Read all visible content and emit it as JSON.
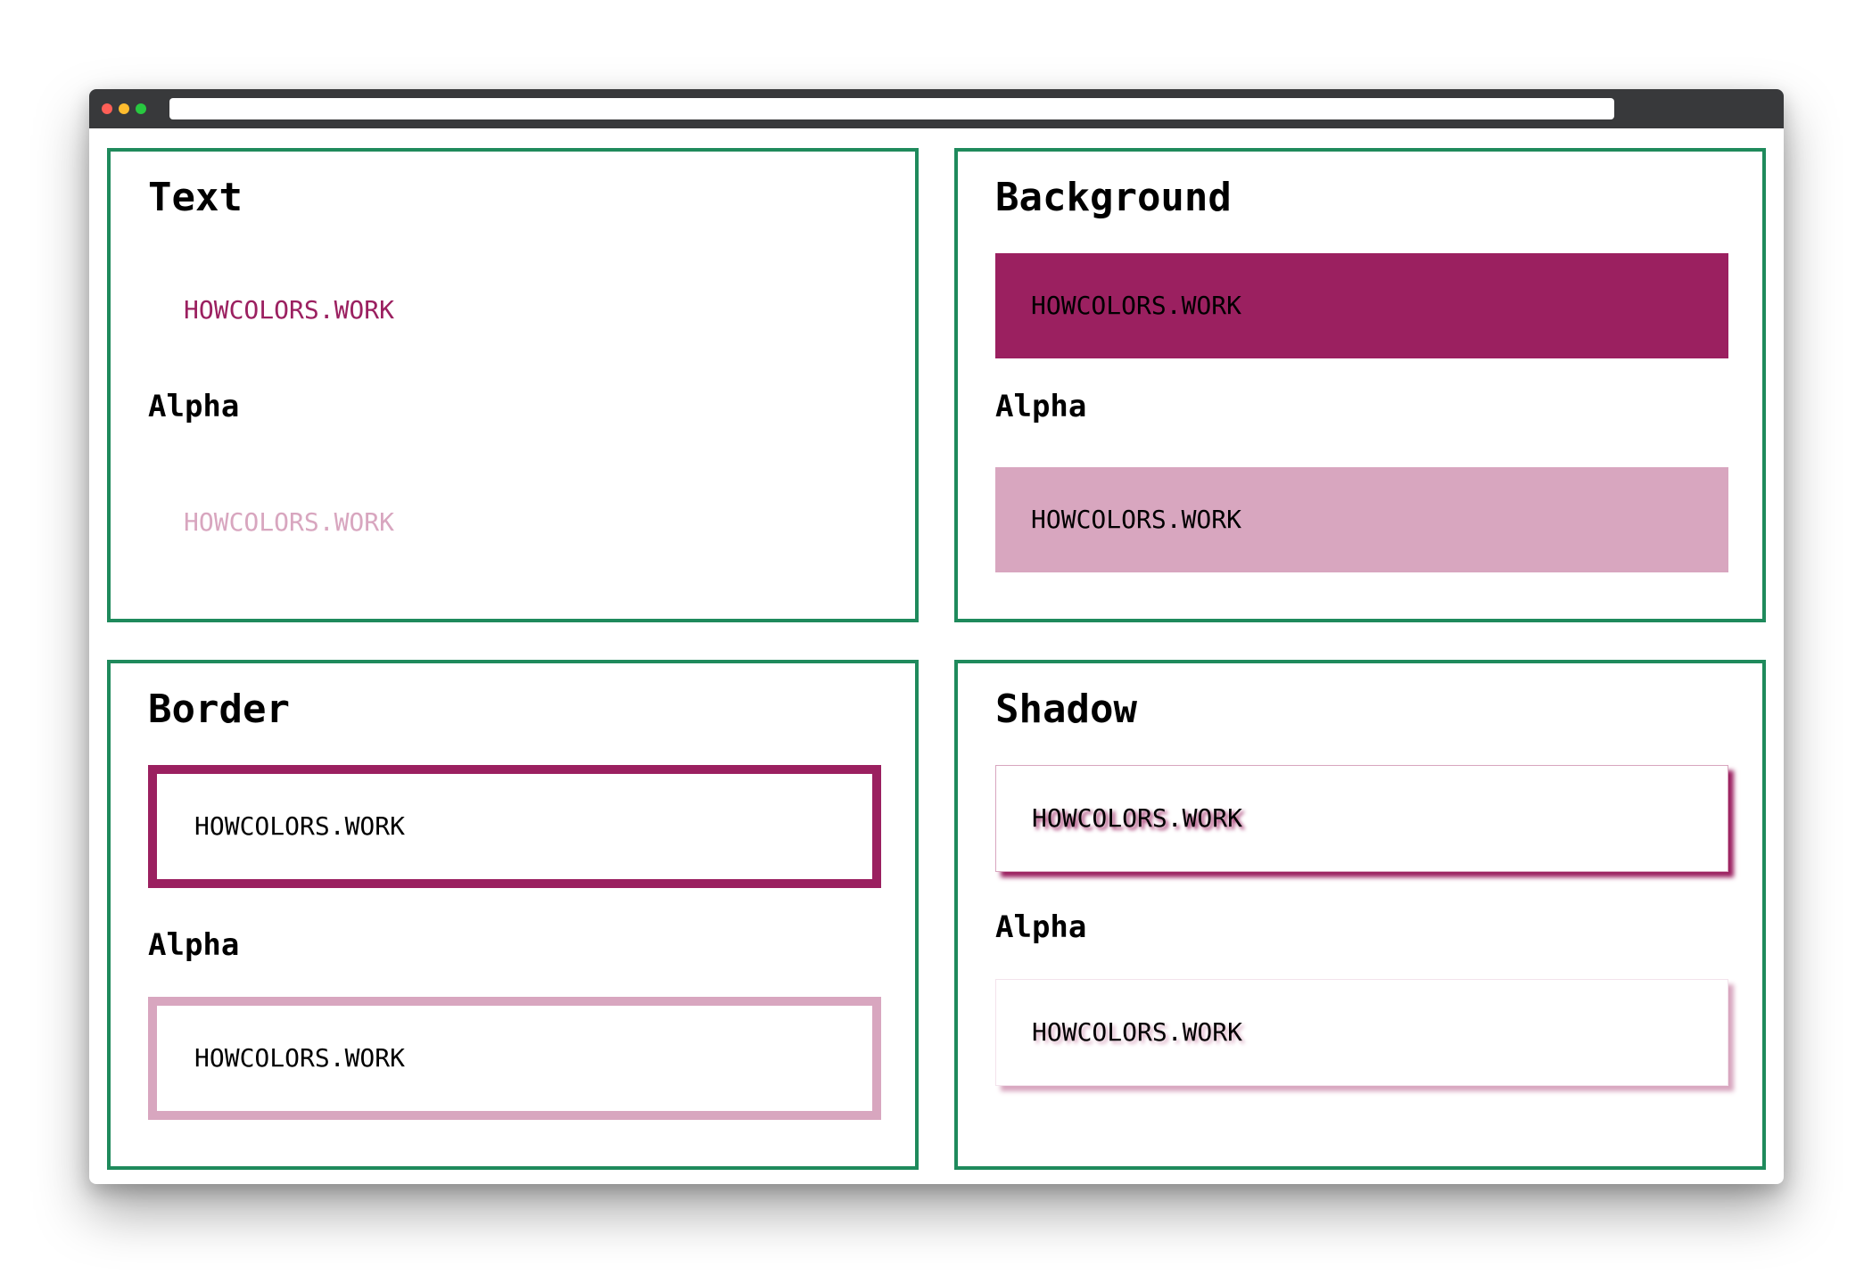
{
  "colors": {
    "accent": "#9b2060",
    "accent_alpha": "#d8a6bf",
    "panel_border": "#1f8a5c",
    "titlebar": "#38393b",
    "dot_red": "#fe5f57",
    "dot_yellow": "#febc2e",
    "dot_green": "#28c840"
  },
  "text_panel": {
    "title": "Text",
    "sample": "HOWCOLORS.WORK",
    "alpha_label": "Alpha",
    "alpha_sample": "HOWCOLORS.WORK"
  },
  "background_panel": {
    "title": "Background",
    "sample": "HOWCOLORS.WORK",
    "alpha_label": "Alpha",
    "alpha_sample": "HOWCOLORS.WORK"
  },
  "border_panel": {
    "title": "Border",
    "sample": "HOWCOLORS.WORK",
    "alpha_label": "Alpha",
    "alpha_sample": "HOWCOLORS.WORK"
  },
  "shadow_panel": {
    "title": "Shadow",
    "sample": "HOWCOLORS.WORK",
    "alpha_label": "Alpha",
    "alpha_sample": "HOWCOLORS.WORK"
  }
}
